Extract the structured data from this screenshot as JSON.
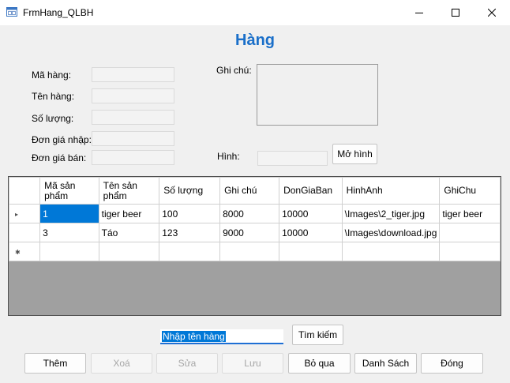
{
  "window": {
    "title": "FrmHang_QLBH"
  },
  "heading": "Hàng",
  "form": {
    "ma_hang_label": "Mã hàng:",
    "ten_hang_label": "Tên hàng:",
    "so_luong_label": "Số lượng:",
    "don_gia_nhap_label": "Đơn giá nhập:",
    "don_gia_ban_label": "Đơn giá bán:",
    "ghi_chu_label": "Ghi chú:",
    "hinh_label": "Hình:",
    "mo_hinh_button": "Mở hình"
  },
  "grid": {
    "columns": [
      "Mã sản\nphẩm",
      "Tên sản\nphẩm",
      "Số lượng",
      "Ghi chú",
      "DonGiaBan",
      "HinhAnh",
      "GhiChu"
    ],
    "rows": [
      [
        "1",
        "tiger beer",
        "100",
        "8000",
        "10000",
        "\\Images\\2_tiger.jpg",
        "tiger beer"
      ],
      [
        "3",
        "Táo",
        "123",
        "9000",
        "10000",
        "\\Images\\download.jpg",
        ""
      ]
    ],
    "current_row_marker": "▸",
    "new_row_marker": "✱"
  },
  "search": {
    "value": "Nhập tên hàng",
    "button": "Tìm kiếm"
  },
  "actions": {
    "them": "Thêm",
    "xoa": "Xoá",
    "sua": "Sửa",
    "luu": "Lưu",
    "bo_qua": "Bỏ qua",
    "danh_sach": "Danh Sách",
    "dong": "Đóng"
  }
}
